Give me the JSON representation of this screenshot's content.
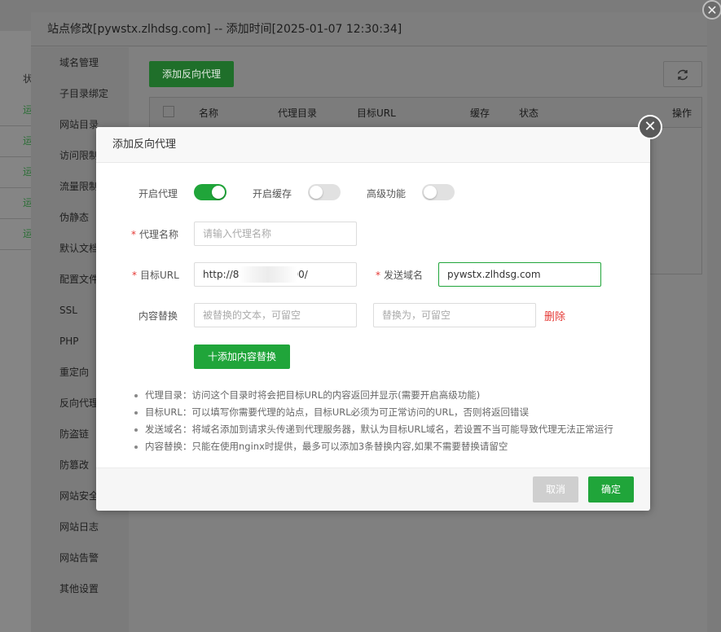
{
  "outer_dialog": {
    "title": "站点修改[pywstx.zlhdsg.com] -- 添加时间[2025-01-07 12:30:34]",
    "close_glyph": "✕",
    "nav_items": [
      "域名管理",
      "子目录绑定",
      "网站目录",
      "访问限制",
      "流量限制",
      "伪静态",
      "默认文档",
      "配置文件",
      "SSL",
      "PHP",
      "重定向",
      "反向代理",
      "防盗链",
      "防篡改",
      "网站安全",
      "网站日志",
      "网站告警",
      "其他设置"
    ],
    "add_proxy_button": "添加反向代理",
    "refresh_icon": "refresh-icon",
    "table_headers": [
      "名称",
      "代理目录",
      "目标URL",
      "缓存",
      "状态",
      "操作"
    ]
  },
  "background": {
    "rows": [
      "运",
      "运",
      "运",
      "运",
      "运"
    ],
    "header_fragment": "状"
  },
  "modal": {
    "title": "添加反向代理",
    "close_glyph": "✕",
    "toggles": [
      {
        "label": "开启代理",
        "on": true
      },
      {
        "label": "开启缓存",
        "on": false
      },
      {
        "label": "高级功能",
        "on": false
      }
    ],
    "proxy_name_label": "代理名称",
    "proxy_name_placeholder": "请输入代理名称",
    "target_url_label": "目标URL",
    "target_url_value": "http://8          7:5000/",
    "send_domain_label": "发送域名",
    "send_domain_value": "pywstx.zlhdsg.com",
    "content_replace_label": "内容替换",
    "replace_from_placeholder": "被替换的文本，可留空",
    "replace_to_placeholder": "替换为，可留空",
    "delete_label": "删除",
    "add_content_button": "十添加内容替换",
    "tips": [
      "代理目录：访问这个目录时将会把目标URL的内容返回并显示(需要开启高级功能)",
      "目标URL：可以填写你需要代理的站点，目标URL必须为可正常访问的URL，否则将返回错误",
      "发送域名：将域名添加到请求头传递到代理服务器，默认为目标URL域名，若设置不当可能导致代理无法正常运行",
      "内容替换：只能在使用nginx时提供，最多可以添加3条替换内容,如果不需要替换请留空"
    ],
    "cancel_label": "取消",
    "ok_label": "确定"
  },
  "colors": {
    "accent": "#20a53a",
    "danger": "#e53935"
  }
}
